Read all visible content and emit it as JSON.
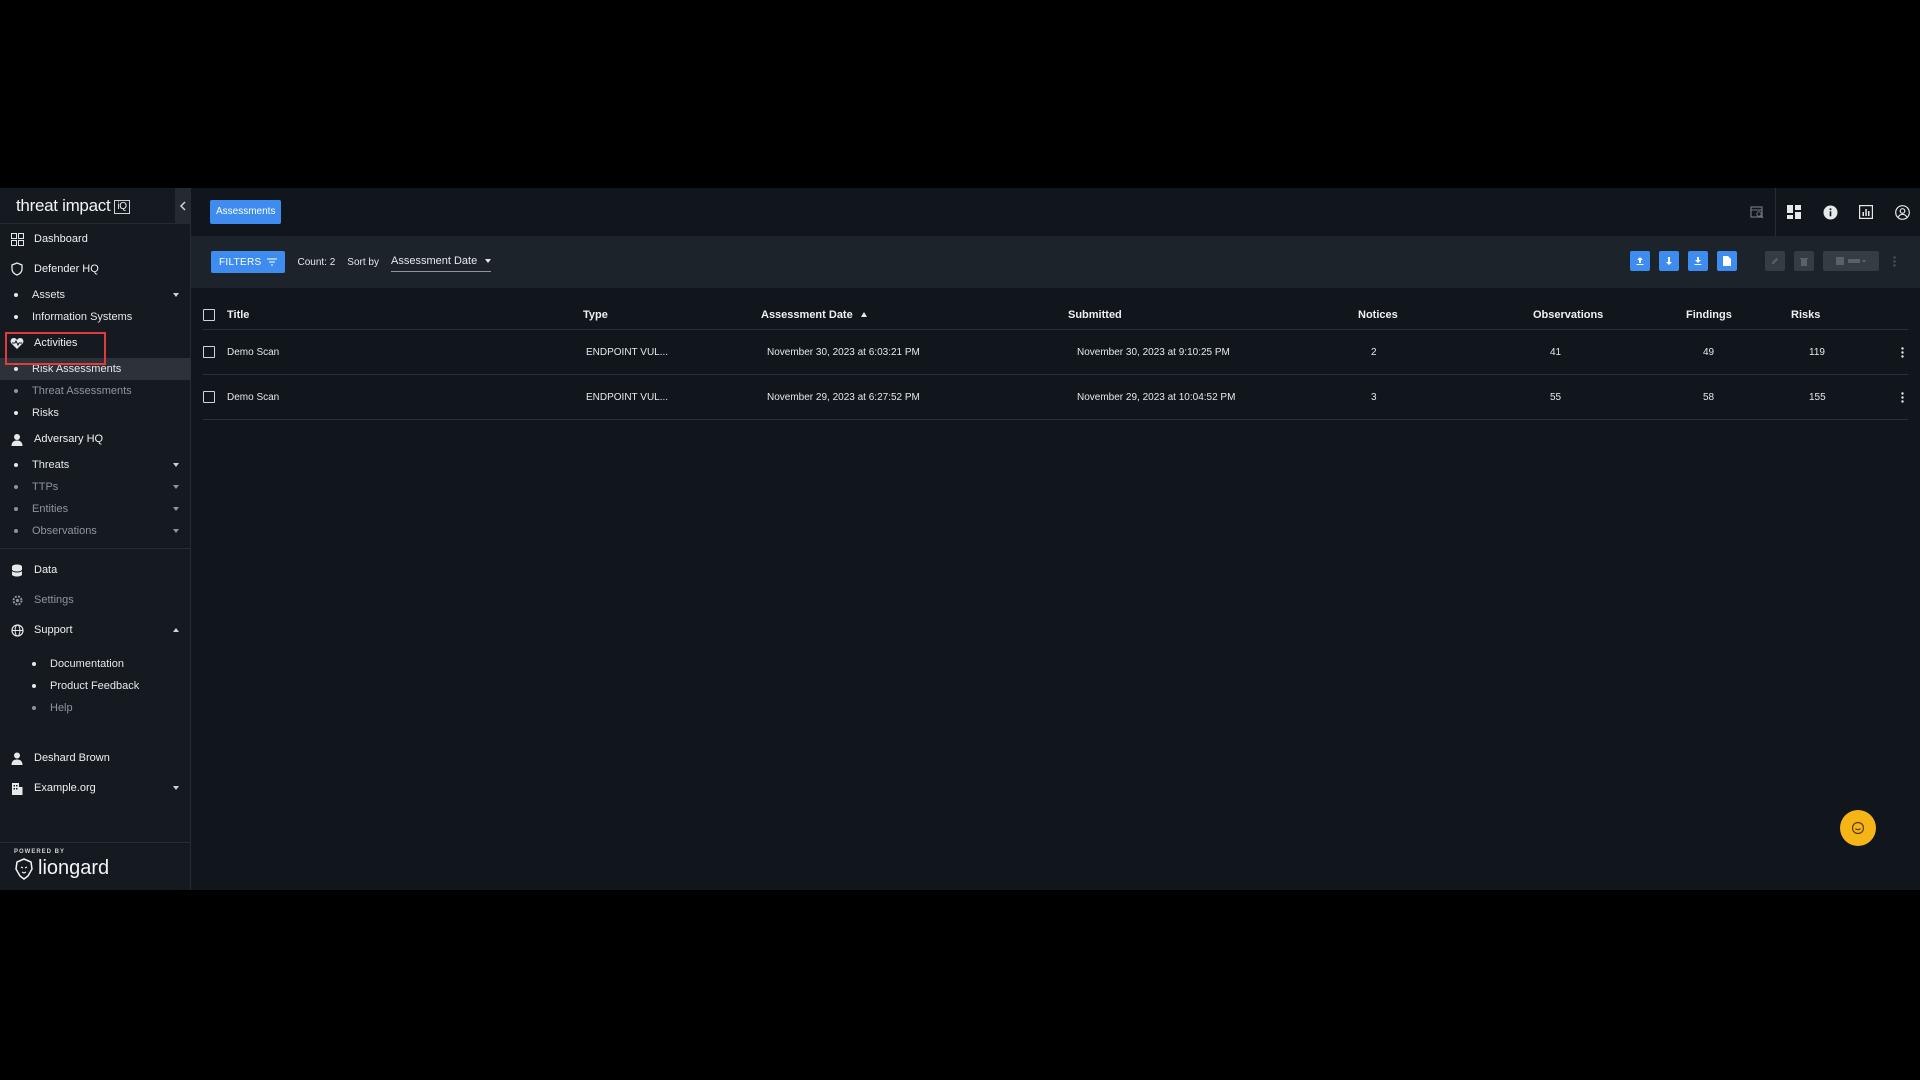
{
  "sidebar": {
    "logo_text": "threat impact",
    "logo_badge": "iQ",
    "items": {
      "dashboard": "Dashboard",
      "defender_hq": "Defender HQ",
      "assets": "Assets",
      "information_systems": "Information Systems",
      "activities": "Activities",
      "risk_assessments": "Risk Assessments",
      "threat_assessments": "Threat Assessments",
      "risks": "Risks",
      "adversary_hq": "Adversary HQ",
      "threats": "Threats",
      "ttps": "TTPs",
      "entities": "Entities",
      "observations": "Observations",
      "data": "Data",
      "settings": "Settings",
      "support": "Support",
      "documentation": "Documentation",
      "product_feedback": "Product Feedback",
      "help": "Help",
      "user": "Deshard Brown",
      "org": "Example.org"
    },
    "powered_by": "POWERED BY",
    "powered_brand": "liongard"
  },
  "header": {
    "tab_label": "Assessments"
  },
  "toolbar": {
    "filters_label": "FILTERS",
    "count_label": "Count: 2",
    "sort_by_label": "Sort by",
    "sort_value": "Assessment Date"
  },
  "table": {
    "columns": {
      "title": "Title",
      "type": "Type",
      "assessment_date": "Assessment Date",
      "submitted": "Submitted",
      "notices": "Notices",
      "observations": "Observations",
      "findings": "Findings",
      "risks": "Risks"
    },
    "rows": [
      {
        "title": "Demo Scan",
        "type": "ENDPOINT VUL...",
        "assessment_date": "November 30, 2023 at 6:03:21 PM",
        "submitted": "November 30, 2023 at 9:10:25 PM",
        "notices": "2",
        "observations": "41",
        "findings": "49",
        "risks": "119"
      },
      {
        "title": "Demo Scan",
        "type": "ENDPOINT VUL...",
        "assessment_date": "November 29, 2023 at 6:27:52 PM",
        "submitted": "November 29, 2023 at 10:04:52 PM",
        "notices": "3",
        "observations": "55",
        "findings": "58",
        "risks": "155"
      }
    ]
  },
  "colors": {
    "accent": "#3f8cf0",
    "highlight": "#e23b3b",
    "fab": "#f5b517"
  }
}
